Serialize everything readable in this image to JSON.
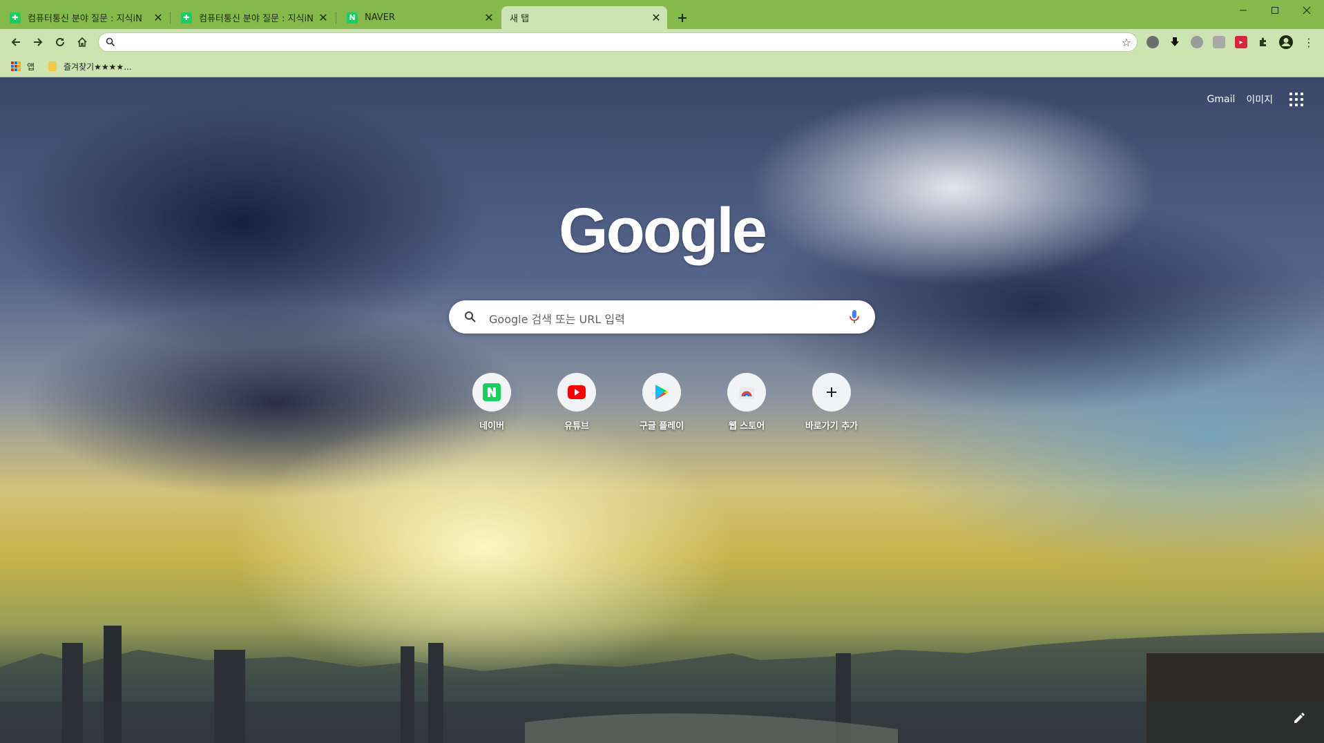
{
  "tabs": [
    {
      "title": "컴퓨터통신 분야 질문 : 지식iN",
      "favicon": "naver-kin-icon"
    },
    {
      "title": "컴퓨터통신 분야 질문 : 지식iN",
      "favicon": "naver-kin-icon"
    },
    {
      "title": "NAVER",
      "favicon": "naver-icon",
      "favicon_text": "N"
    },
    {
      "title": "새 탭",
      "active": true
    }
  ],
  "toolbar": {
    "omnibox_value": "",
    "back_icon": "back-arrow-icon",
    "forward_icon": "forward-arrow-icon",
    "reload_icon": "reload-icon",
    "home_icon": "home-icon"
  },
  "bookmarks": {
    "apps_label": "앱",
    "folder_label": "즐겨찾기★★★★..."
  },
  "ntp": {
    "gmail": "Gmail",
    "images": "이미지",
    "logo": "Google",
    "search_placeholder": "Google 검색 또는 URL 입력",
    "shortcuts": [
      {
        "label": "네이버",
        "icon": "naver-icon"
      },
      {
        "label": "유튜브",
        "icon": "youtube-icon"
      },
      {
        "label": "구글 플레이",
        "icon": "google-play-icon"
      },
      {
        "label": "웹 스토어",
        "icon": "web-store-icon"
      },
      {
        "label": "바로가기 추가",
        "icon": "plus-icon"
      }
    ]
  },
  "colors": {
    "frame": "#86b94c",
    "toolbar": "#cde3b1",
    "naver_green": "#19ce60",
    "youtube_red": "#ff0000"
  }
}
